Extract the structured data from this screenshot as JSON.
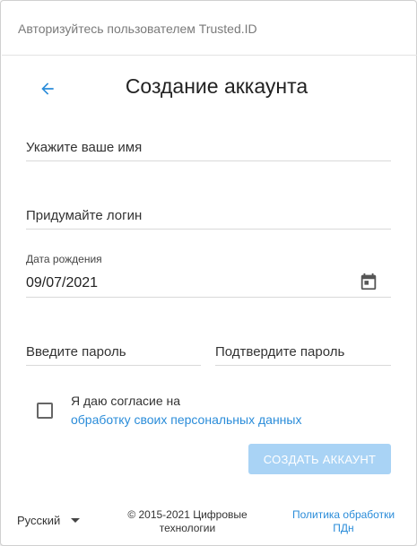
{
  "header": {
    "text": "Авторизуйтесь пользователем Trusted.ID"
  },
  "title": "Создание аккаунта",
  "form": {
    "name_label": "Укажите ваше имя",
    "login_label": "Придумайте логин",
    "birthdate_label": "Дата рождения",
    "birthdate_value": "09/07/2021",
    "password_label": "Введите пароль",
    "confirm_label": "Подтвердите пароль"
  },
  "consent": {
    "text": "Я даю согласие на",
    "link": "обработку своих персональных данных",
    "checked": false
  },
  "create_button": "СОЗДАТЬ АККАУНТ",
  "footer": {
    "language": "Русский",
    "copyright_line1": "© 2015-2021 Цифровые",
    "copyright_line2": "технологии",
    "policy_line1": "Политика обработки",
    "policy_line2": "ПДн"
  },
  "colors": {
    "accent": "#2a8cd9",
    "button_disabled": "#a9d3f5",
    "divider": "#d9d9d9"
  },
  "icons": {
    "back": "arrow-left-icon",
    "calendar": "calendar-icon",
    "dropdown": "caret-down-icon"
  }
}
